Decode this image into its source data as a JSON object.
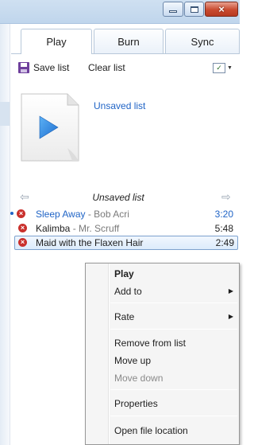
{
  "window": {
    "min_icon": "minimize-icon",
    "max_icon": "maximize-icon",
    "close_icon": "close-icon",
    "close_glyph": "×"
  },
  "tabs": [
    {
      "label": "Play",
      "active": true
    },
    {
      "label": "Burn",
      "active": false
    },
    {
      "label": "Sync",
      "active": false
    }
  ],
  "toolbar": {
    "save_label": "Save list",
    "clear_label": "Clear list",
    "save_icon": "floppy-disk-icon",
    "options_icon": "list-options-icon",
    "options_glyph": "✓"
  },
  "playlist": {
    "title_link": "Unsaved list",
    "nav_title": "Unsaved list",
    "back_glyph": "⇦",
    "forward_glyph": "⇨",
    "items": [
      {
        "title": "Sleep Away",
        "separator": " - ",
        "artist": "Bob Acri",
        "duration": "3:20",
        "state": "playing"
      },
      {
        "title": "Kalimba",
        "separator": " - ",
        "artist": "Mr. Scruff",
        "duration": "5:48",
        "state": "normal"
      },
      {
        "title": "Maid with the Flaxen Hair",
        "separator": "",
        "artist": "",
        "duration": "2:49",
        "state": "selected"
      }
    ],
    "remove_glyph": "×"
  },
  "context_menu": {
    "play": "Play",
    "add_to": "Add to",
    "rate": "Rate",
    "remove": "Remove from list",
    "move_up": "Move up",
    "move_down": "Move down",
    "properties": "Properties",
    "open_location": "Open file location",
    "submenu_glyph": "▶"
  },
  "colors": {
    "accent_blue": "#2064c6",
    "remove_red": "#c9302c",
    "play_blue": "#2f86e0"
  }
}
